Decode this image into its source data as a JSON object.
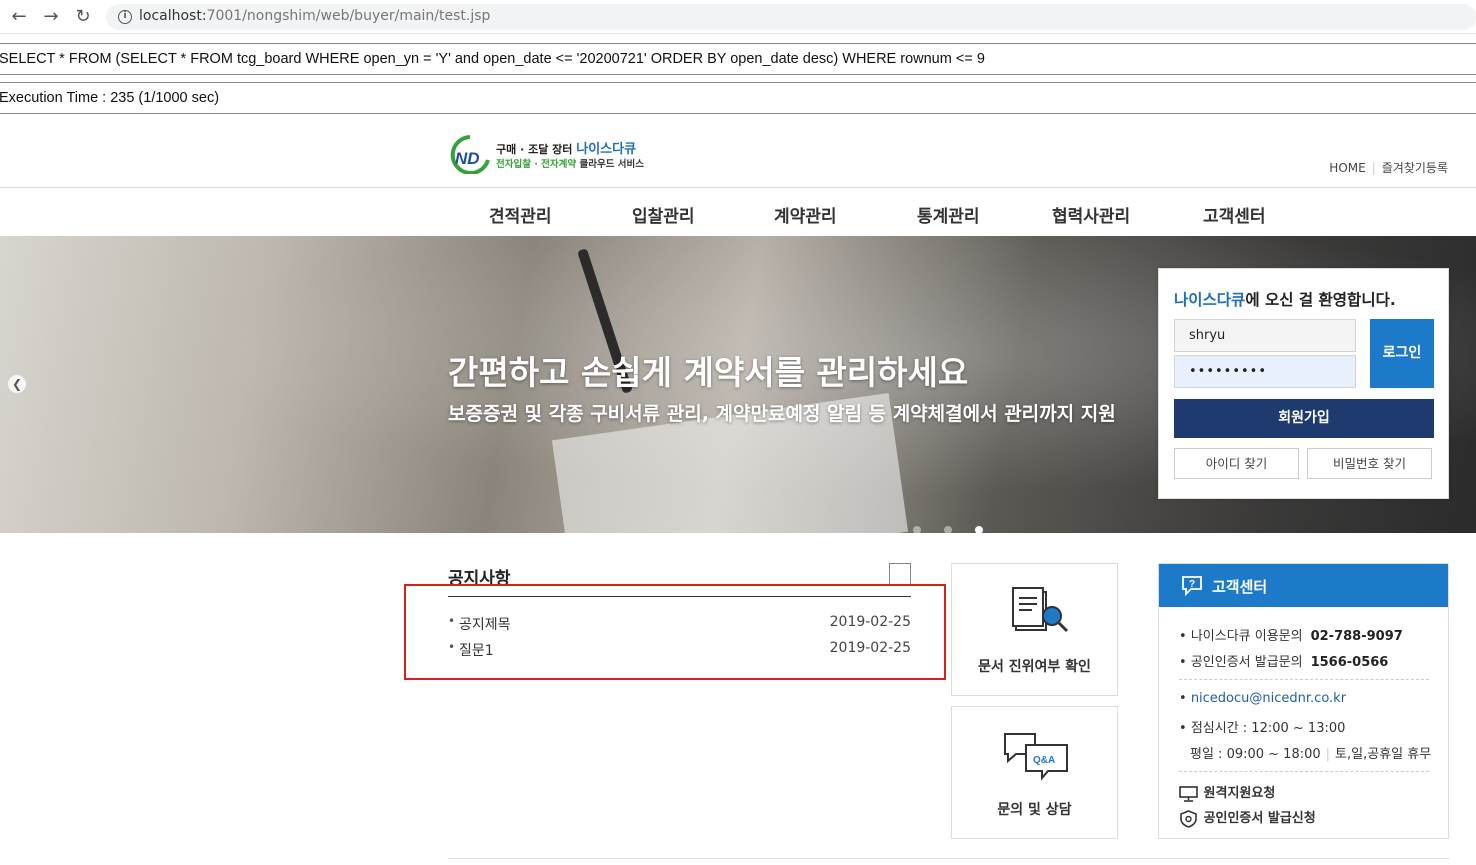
{
  "browser": {
    "url_host": "localhost:",
    "url_path": "7001/nongshim/web/buyer/main/test.jsp"
  },
  "debug": {
    "sql": "SELECT * FROM (SELECT * FROM tcg_board WHERE open_yn = 'Y' and open_date <= '20200721' ORDER BY open_date desc) WHERE rownum <= 9",
    "exec_time": "Execution Time : 235 (1/1000 sec)"
  },
  "logo": {
    "line1_prefix": "구매 · 조달 장터",
    "line1_brand": "나이스다큐",
    "line2_green": "전자입찰 · 전자계약",
    "line2_rest": "클라우드 서비스"
  },
  "util": {
    "home": "HOME",
    "favorite": "즐겨찾기등록"
  },
  "gnb": [
    "견적관리",
    "입찰관리",
    "계약관리",
    "통계관리",
    "협력사관리",
    "고객센터"
  ],
  "hero": {
    "title": "간편하고 손쉽게 계약서를 관리하세요",
    "subtitle": "보증증권 및 각종 구비서류 관리, 계약만료예정 알림 등 계약체결에서 관리까지 지원",
    "active_slide": 3,
    "slide_count": 3
  },
  "login": {
    "title_brand": "나이스다큐",
    "title_rest": "에 오신 걸 환영합니다.",
    "id_value": "shryu",
    "pw_value": "•••••••••",
    "login_label": "로그인",
    "join_label": "회원가입",
    "find_id_label": "아이디 찾기",
    "find_pw_label": "비밀번호 찾기"
  },
  "notice": {
    "title": "공지사항",
    "items": [
      {
        "title": "공지제목",
        "date": "2019-02-25"
      },
      {
        "title": "질문1",
        "date": "2019-02-25"
      }
    ]
  },
  "quick": {
    "verify_label": "문서 진위여부 확인",
    "qna_label": "문의 및 상담",
    "qna_icon_text": "Q&A"
  },
  "cs": {
    "title": "고객센터",
    "inquiry_label": "나이스다큐 이용문의",
    "inquiry_phone": "02-788-9097",
    "cert_label": "공인인증서 발급문의",
    "cert_phone": "1566-0566",
    "email": "nicedocu@nicednr.co.kr",
    "lunch": "점심시간 : 12:00 ~ 13:00",
    "weekday": "평일 : 09:00 ~ 18:00",
    "holiday": "토,일,공휴일 휴무",
    "remote_label": "원격지원요청",
    "cert_apply_label": "공인인증서 발급신청"
  },
  "colors": {
    "brand_blue": "#1c7ac8",
    "navy": "#1f3a6e",
    "green": "#35a13b",
    "highlight_red": "#d32020"
  }
}
